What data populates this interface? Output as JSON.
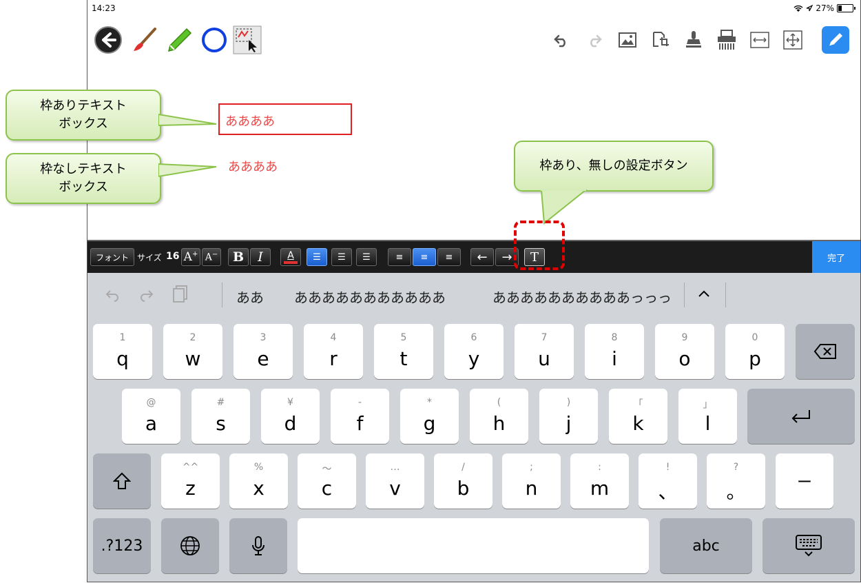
{
  "status": {
    "time": "14:23",
    "battery": "27%"
  },
  "canvas": {
    "framed_text": "ああああ",
    "unframed_text": "ああああ"
  },
  "format_bar": {
    "font_label": "フォント",
    "size_label": "サイズ",
    "size_value": "16",
    "bold": "B",
    "italic": "I",
    "color": "A",
    "border_toggle": "T",
    "done": "完了"
  },
  "suggestions": [
    "ああ",
    "あああああああああああ",
    "ああああああああああっっっ"
  ],
  "keyboard": {
    "row1": [
      {
        "k": "q",
        "s": "1"
      },
      {
        "k": "w",
        "s": "2"
      },
      {
        "k": "e",
        "s": "3"
      },
      {
        "k": "r",
        "s": "4"
      },
      {
        "k": "t",
        "s": "5"
      },
      {
        "k": "y",
        "s": "6"
      },
      {
        "k": "u",
        "s": "7"
      },
      {
        "k": "i",
        "s": "8"
      },
      {
        "k": "o",
        "s": "9"
      },
      {
        "k": "p",
        "s": "0"
      }
    ],
    "row2": [
      {
        "k": "a",
        "s": "@"
      },
      {
        "k": "s",
        "s": "#"
      },
      {
        "k": "d",
        "s": "¥"
      },
      {
        "k": "f",
        "s": "-"
      },
      {
        "k": "g",
        "s": "*"
      },
      {
        "k": "h",
        "s": "("
      },
      {
        "k": "j",
        "s": ")"
      },
      {
        "k": "k",
        "s": "「"
      },
      {
        "k": "l",
        "s": "」"
      }
    ],
    "row3": [
      {
        "k": "z",
        "s": "^^"
      },
      {
        "k": "x",
        "s": "%"
      },
      {
        "k": "c",
        "s": "〜"
      },
      {
        "k": "v",
        "s": "…"
      },
      {
        "k": "b",
        "s": "/"
      },
      {
        "k": "n",
        "s": ";"
      },
      {
        "k": "m",
        "s": ":"
      },
      {
        "k": "、",
        "s": "!"
      },
      {
        "k": "。",
        "s": "?"
      },
      {
        "k": "ー",
        "s": ""
      }
    ],
    "numbers_key": ".?123",
    "abc_key": "abc"
  },
  "callouts": {
    "framed": "枠ありテキスト\nボックス",
    "unframed": "枠なしテキスト\nボックス",
    "setting_button": "枠あり、無しの設定ボタン"
  },
  "colors": {
    "accent": "#2a8cf0",
    "text_red": "#e84a4a",
    "callout_border": "#8cc34a"
  }
}
